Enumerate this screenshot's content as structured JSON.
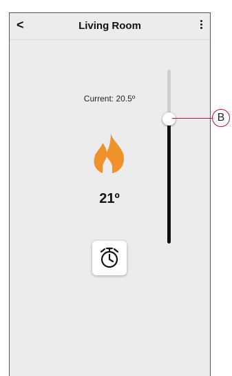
{
  "header": {
    "back_icon": "chevron-left-icon",
    "back_glyph": "<",
    "title": "Living Room",
    "more_icon": "vertical-ellipsis-icon"
  },
  "thermostat": {
    "current_label": "Current: 20.5º",
    "mode_icon": "flame-icon",
    "mode_color": "#f0922b",
    "setpoint": "21º",
    "timer_icon": "alarm-clock-icon"
  },
  "slider": {
    "level_fraction": 0.72,
    "fill_color": "#111111",
    "track_color": "#cfcfcf"
  },
  "annotation": {
    "label": "B",
    "color": "#c8102e"
  }
}
